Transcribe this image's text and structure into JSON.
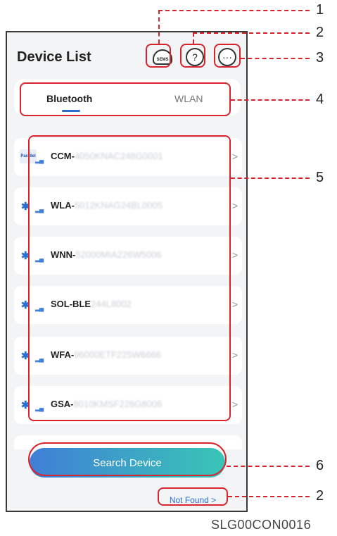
{
  "header": {
    "title": "Device List"
  },
  "icons": {
    "cloud_text": "SEMS",
    "help_symbol": "?",
    "more_symbol": "···"
  },
  "tabs": [
    {
      "label": "Bluetooth",
      "active": true
    },
    {
      "label": "WLAN",
      "active": false
    }
  ],
  "devices": [
    {
      "icon": "parallel-icon",
      "prefix": "CCM-",
      "serial": "4050KNAC248G0001"
    },
    {
      "icon": "bluetooth-icon",
      "prefix": "WLA-",
      "serial": "5012KNAG24BL0005"
    },
    {
      "icon": "bluetooth-icon",
      "prefix": "WNN-",
      "serial": "52000MIA226W5006"
    },
    {
      "icon": "bluetooth-icon",
      "prefix": "SOL-BLE",
      "serial": "244L8002"
    },
    {
      "icon": "bluetooth-icon",
      "prefix": "WFA-",
      "serial": "96000ETF225W6666"
    },
    {
      "icon": "bluetooth-icon",
      "prefix": "GSA-",
      "serial": "8010KMSF226G8006"
    }
  ],
  "parallel_label": "Parallel",
  "chevron": ">",
  "search_button": "Search Device",
  "not_found_link": "Not Found >",
  "callouts": [
    "1",
    "2",
    "3",
    "4",
    "5",
    "2",
    "6"
  ],
  "figure_code": "SLG00CON0016",
  "colors": {
    "accent": "#2a6fd1",
    "annotation": "#d9232d",
    "gradient_start": "#3f7fd6",
    "gradient_end": "#39c6b6"
  }
}
